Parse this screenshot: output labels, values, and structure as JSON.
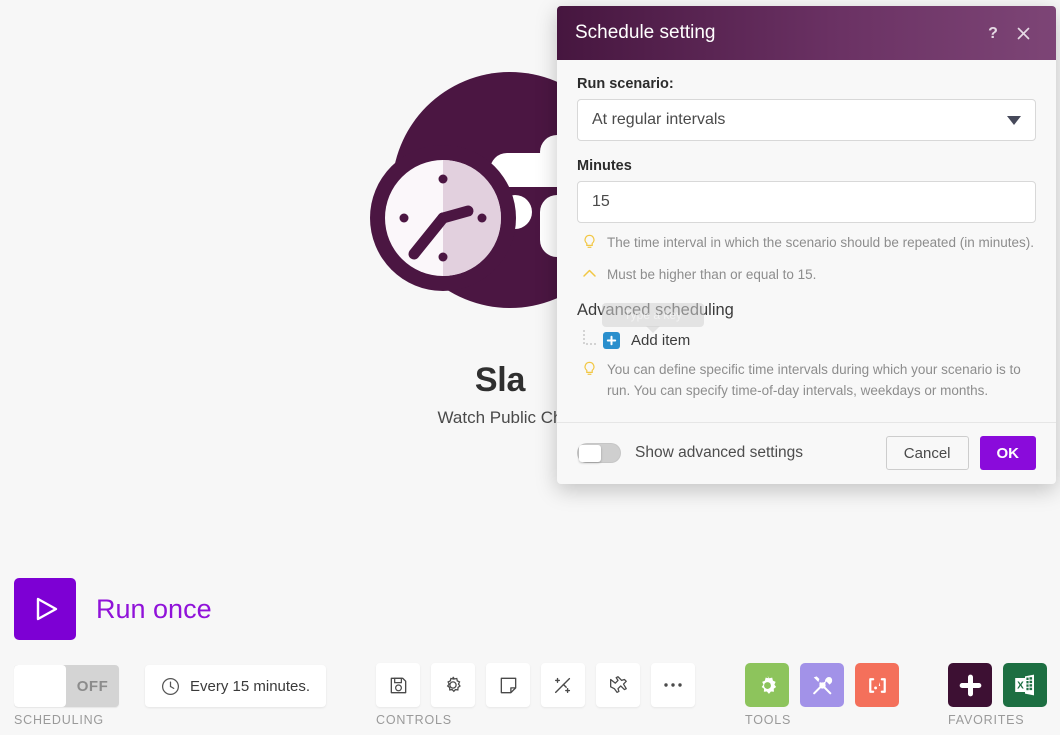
{
  "background": {
    "module": {
      "title": "Sla",
      "subtitle": "Watch Public Ch",
      "logo_icon": "slack-clock-icon"
    }
  },
  "dialog": {
    "title": "Schedule setting",
    "help_icon": "question-mark-icon",
    "close_icon": "close-icon",
    "run_scenario": {
      "label": "Run scenario:",
      "value": "At regular intervals",
      "caret_icon": "chevron-down-icon"
    },
    "minutes": {
      "label": "Minutes",
      "value": "15",
      "hint": "The time interval in which the scenario should be repeated (in minutes).",
      "hint_icon": "lightbulb-icon",
      "validation": "Must be higher than or equal to 15.",
      "validation_icon": "chevron-up-icon"
    },
    "ghost_tooltip": "Type a key",
    "advanced": {
      "title": "Advanced scheduling",
      "add_item_label": "Add item",
      "add_item_icon": "plus-square-icon",
      "hint": "You can define specific time intervals during which your scenario is to run. You can specify time-of-day intervals, weekdays or months.",
      "hint_icon": "lightbulb-icon"
    },
    "footer": {
      "show_advanced_label": "Show advanced settings",
      "show_advanced_state": "off",
      "cancel_label": "Cancel",
      "ok_label": "OK"
    },
    "colors": {
      "header_gradient_start": "#46163f",
      "header_gradient_end": "#7d4576",
      "ok_button": "#8a0bdb",
      "add_item_blue": "#2a8fcd",
      "hint_yellow": "#f2c744"
    }
  },
  "toolbar": {
    "run_once_label": "Run once",
    "run_once_icon": "play-icon",
    "scheduling": {
      "group_label": "SCHEDULING",
      "toggle_state": "OFF",
      "interval_text": "Every 15 minutes.",
      "clock_icon": "clock-icon"
    },
    "controls": {
      "group_label": "CONTROLS",
      "buttons": [
        {
          "name": "save-button",
          "icon": "floppy-disk-icon"
        },
        {
          "name": "settings-button",
          "icon": "gear-icon"
        },
        {
          "name": "notes-button",
          "icon": "note-icon"
        },
        {
          "name": "autoalign-button",
          "icon": "magic-wand-icon"
        },
        {
          "name": "explorer-button",
          "icon": "airplane-icon"
        },
        {
          "name": "more-button",
          "icon": "ellipsis-icon"
        }
      ]
    },
    "tools": {
      "group_label": "TOOLS",
      "buttons": [
        {
          "name": "tools-gear-button",
          "icon": "gear-icon",
          "color": "#8dc45c"
        },
        {
          "name": "tools-utility-button",
          "icon": "wrench-screwdriver-icon",
          "color": "#a292e8"
        },
        {
          "name": "tools-json-button",
          "icon": "json-brackets-icon",
          "color": "#f4705b"
        }
      ]
    },
    "favorites": {
      "group_label": "FAVORITES",
      "buttons": [
        {
          "name": "favorite-slack-button",
          "icon": "slack-icon",
          "color": "#3d1033"
        },
        {
          "name": "favorite-excel-button",
          "icon": "excel-icon",
          "color": "#1d6f42"
        }
      ]
    }
  }
}
